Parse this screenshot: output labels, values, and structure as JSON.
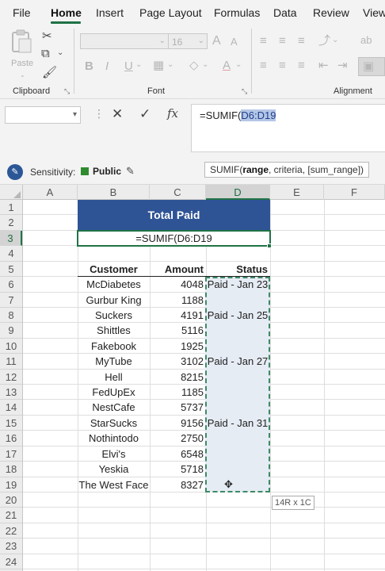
{
  "menu": {
    "tabs": [
      "File",
      "Home",
      "Insert",
      "Page Layout",
      "Formulas",
      "Data",
      "Review",
      "View"
    ],
    "active": "Home"
  },
  "ribbon": {
    "clipboard": {
      "label": "Clipboard",
      "paste_label": "Paste"
    },
    "font": {
      "label": "Font",
      "size": "16",
      "grow": "A",
      "shrink": "A",
      "bold": "B",
      "italic": "I",
      "underline": "U"
    },
    "alignment": {
      "label": "Alignment"
    },
    "icons": [
      "clipboard-icon",
      "scissors-icon",
      "copy-icon",
      "format-painter-icon",
      "borders-icon",
      "fill-color-icon",
      "font-color-icon",
      "align-icon",
      "wrap-text-icon",
      "merge-icon"
    ]
  },
  "formula_bar": {
    "name_box": "",
    "cancel": "✕",
    "enter": "✓",
    "fx": "fx",
    "formula_prefix": "=SUMIF(",
    "formula_range": "D6:D19"
  },
  "sensitivity": {
    "label": "Sensitivity:",
    "value": "Public",
    "color": "#2e8b2e"
  },
  "tooltip": {
    "prefix": "SUMIF(",
    "bold_arg": "range",
    "suffix": ", criteria, [sum_range])"
  },
  "grid": {
    "columns": [
      "A",
      "B",
      "C",
      "D",
      "E",
      "F"
    ],
    "rows": [
      "1",
      "2",
      "3",
      "4",
      "5",
      "6",
      "7",
      "8",
      "9",
      "10",
      "11",
      "12",
      "13",
      "14",
      "15",
      "16",
      "17",
      "18",
      "19",
      "20",
      "21",
      "22",
      "23",
      "24"
    ],
    "title": "Total Paid",
    "formula_cell": "=SUMIF(D6:D19",
    "headers": {
      "customer": "Customer",
      "amount": "Amount",
      "status": "Status"
    },
    "records": [
      {
        "customer": "McDiabetes",
        "amount": "4048",
        "status": "Paid - Jan 23"
      },
      {
        "customer": "Gurbur King",
        "amount": "1188",
        "status": ""
      },
      {
        "customer": "Suckers",
        "amount": "4191",
        "status": "Paid - Jan 25"
      },
      {
        "customer": "Shittles",
        "amount": "5116",
        "status": ""
      },
      {
        "customer": "Fakebook",
        "amount": "1925",
        "status": ""
      },
      {
        "customer": "MyTube",
        "amount": "3102",
        "status": "Paid - Jan 27"
      },
      {
        "customer": "Hell",
        "amount": "8215",
        "status": ""
      },
      {
        "customer": "FedUpEx",
        "amount": "1185",
        "status": ""
      },
      {
        "customer": "NestCafe",
        "amount": "5737",
        "status": ""
      },
      {
        "customer": "StarSucks",
        "amount": "9156",
        "status": "Paid - Jan 31"
      },
      {
        "customer": "Nothintodo",
        "amount": "2750",
        "status": ""
      },
      {
        "customer": "Elvi's",
        "amount": "6548",
        "status": ""
      },
      {
        "customer": "Yeskia",
        "amount": "5718",
        "status": ""
      },
      {
        "customer": "The West Face",
        "amount": "8327",
        "status": ""
      }
    ],
    "selection_size": "14R x 1C",
    "accent": "#217346",
    "title_fill": "#2f5496"
  }
}
